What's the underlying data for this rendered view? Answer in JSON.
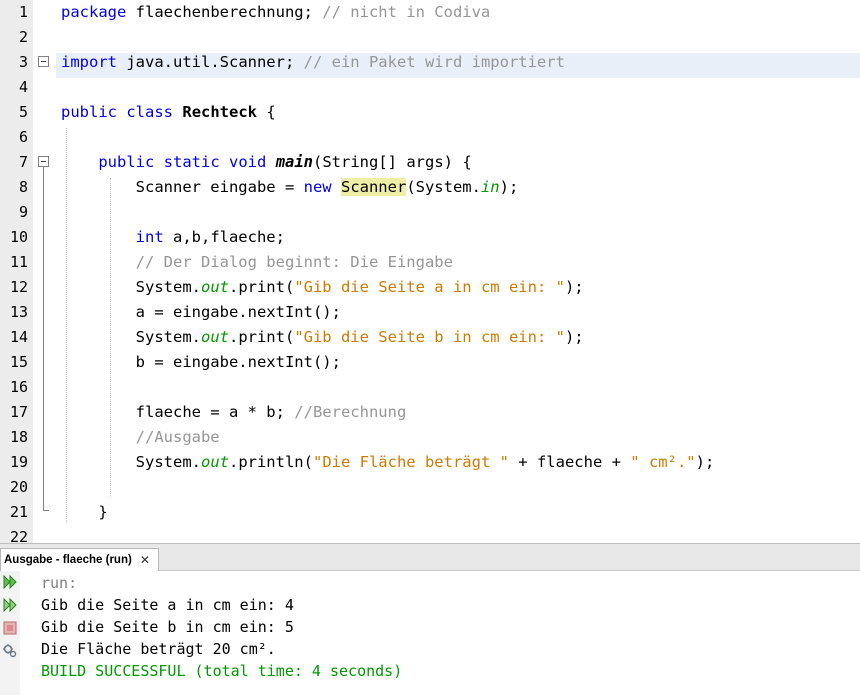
{
  "editor": {
    "line_numbers": [
      "1",
      "2",
      "3",
      "4",
      "5",
      "6",
      "7",
      "8",
      "9",
      "10",
      "11",
      "12",
      "13",
      "14",
      "15",
      "16",
      "17",
      "18",
      "19",
      "20",
      "21",
      "22"
    ],
    "lines": [
      [
        {
          "t": "package",
          "c": "kw"
        },
        {
          "t": " flaechenberechnung; ",
          "c": ""
        },
        {
          "t": "// nicht in Codiva",
          "c": "cm"
        }
      ],
      [],
      [
        {
          "t": "import",
          "c": "kw"
        },
        {
          "t": " java.util.Scanner; ",
          "c": ""
        },
        {
          "t": "// ein Paket wird importiert",
          "c": "cm"
        }
      ],
      [],
      [
        {
          "t": "public",
          "c": "kw"
        },
        {
          "t": " ",
          "c": ""
        },
        {
          "t": "class",
          "c": "kw"
        },
        {
          "t": " ",
          "c": ""
        },
        {
          "t": "Rechteck",
          "c": "b"
        },
        {
          "t": " {",
          "c": ""
        }
      ],
      [],
      [
        {
          "t": "    ",
          "c": ""
        },
        {
          "t": "public",
          "c": "kw"
        },
        {
          "t": " ",
          "c": ""
        },
        {
          "t": "static",
          "c": "kw"
        },
        {
          "t": " ",
          "c": ""
        },
        {
          "t": "void",
          "c": "kw"
        },
        {
          "t": " ",
          "c": ""
        },
        {
          "t": "main",
          "c": "bi"
        },
        {
          "t": "(String[] args) {",
          "c": ""
        }
      ],
      [
        {
          "t": "        Scanner eingabe = ",
          "c": ""
        },
        {
          "t": "new",
          "c": "kw"
        },
        {
          "t": " ",
          "c": ""
        },
        {
          "t": "Scanner",
          "c": "mark"
        },
        {
          "t": "(System.",
          "c": ""
        },
        {
          "t": "in",
          "c": "fi"
        },
        {
          "t": ");",
          "c": ""
        }
      ],
      [],
      [
        {
          "t": "        ",
          "c": ""
        },
        {
          "t": "int",
          "c": "kw"
        },
        {
          "t": " a,b,flaeche;",
          "c": ""
        }
      ],
      [
        {
          "t": "        ",
          "c": ""
        },
        {
          "t": "// Der Dialog beginnt: Die Eingabe",
          "c": "cm"
        }
      ],
      [
        {
          "t": "        System.",
          "c": ""
        },
        {
          "t": "out",
          "c": "fi"
        },
        {
          "t": ".print(",
          "c": ""
        },
        {
          "t": "\"Gib die Seite a in cm ein: \"",
          "c": "st"
        },
        {
          "t": ");",
          "c": ""
        }
      ],
      [
        {
          "t": "        a = eingabe.nextInt();",
          "c": ""
        }
      ],
      [
        {
          "t": "        System.",
          "c": ""
        },
        {
          "t": "out",
          "c": "fi"
        },
        {
          "t": ".print(",
          "c": ""
        },
        {
          "t": "\"Gib die Seite b in cm ein: \"",
          "c": "st"
        },
        {
          "t": ");",
          "c": ""
        }
      ],
      [
        {
          "t": "        b = eingabe.nextInt();",
          "c": ""
        }
      ],
      [],
      [
        {
          "t": "        flaeche = a * b; ",
          "c": ""
        },
        {
          "t": "//Berechnung",
          "c": "cm"
        }
      ],
      [
        {
          "t": "        ",
          "c": ""
        },
        {
          "t": "//Ausgabe",
          "c": "cm"
        }
      ],
      [
        {
          "t": "        System.",
          "c": ""
        },
        {
          "t": "out",
          "c": "fi"
        },
        {
          "t": ".println(",
          "c": ""
        },
        {
          "t": "\"Die Fläche beträgt \"",
          "c": "st"
        },
        {
          "t": " + flaeche + ",
          "c": ""
        },
        {
          "t": "\" cm².\"",
          "c": "st"
        },
        {
          "t": ");",
          "c": ""
        }
      ],
      [],
      [
        {
          "t": "    }",
          "c": ""
        }
      ],
      []
    ]
  },
  "output": {
    "tab_label": "Ausgabe - flaeche (run)",
    "tab_close": "✕",
    "lines": [
      {
        "text": "run:",
        "color": "#808080"
      },
      {
        "text": "Gib die Seite a in cm ein: 4",
        "color": "#000000"
      },
      {
        "text": "Gib die Seite b in cm ein: 5",
        "color": "#000000"
      },
      {
        "text": "Die Fläche beträgt 20 cm².",
        "color": "#000000"
      },
      {
        "text": "BUILD SUCCESSFUL (total time: 4 seconds)",
        "color": "#009900"
      }
    ],
    "tools": [
      "rerun-icon",
      "rerun-with-options-icon",
      "stop-icon",
      "settings-icon"
    ]
  },
  "colors": {
    "keyword": "#0000e6",
    "comment": "#969696",
    "string": "#ce7b00",
    "field": "#009900",
    "highlight_line": "#e9eff8",
    "mark_occurrence": "#eeeea8",
    "build_success": "#009900"
  }
}
